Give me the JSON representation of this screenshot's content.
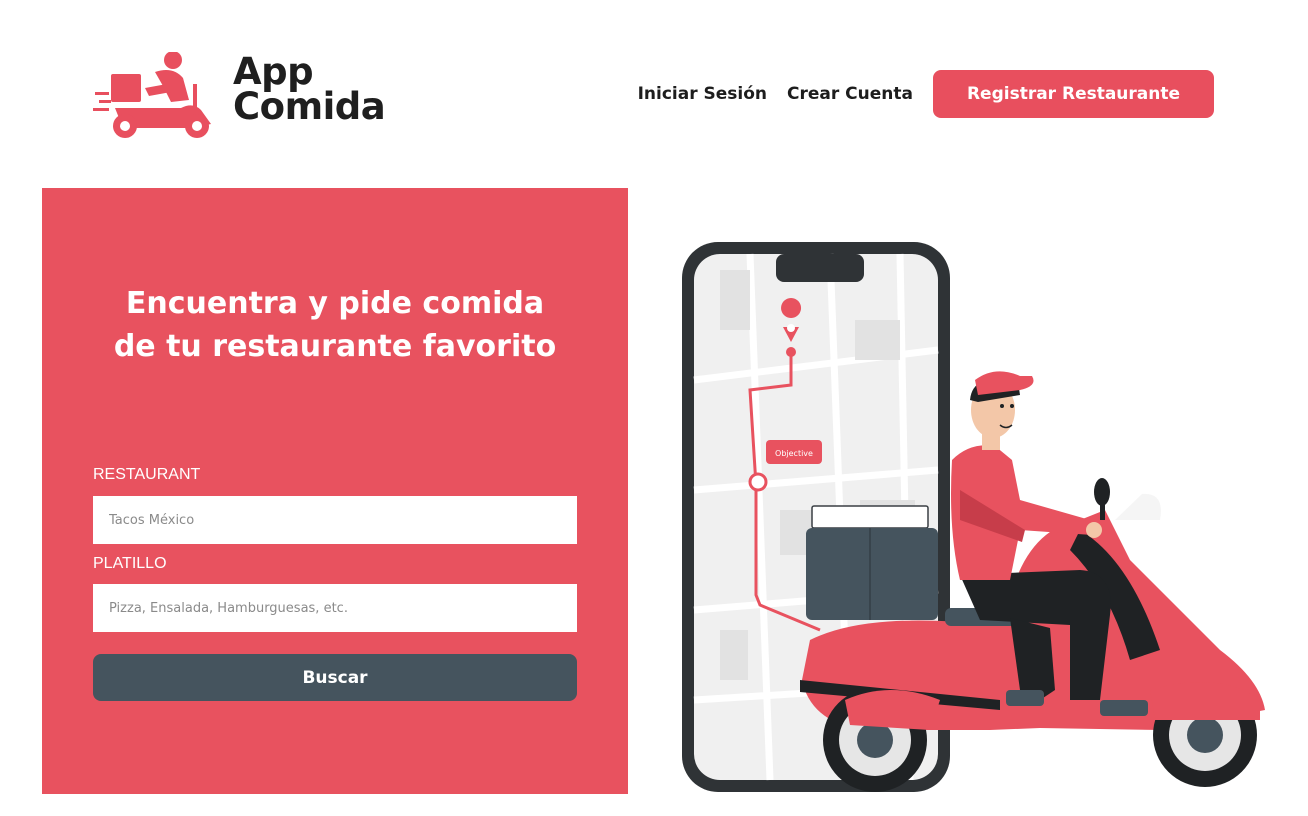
{
  "brand": {
    "line1": "App",
    "line2": "Comida",
    "accent_color": "#e84f5e",
    "icon": "delivery-scooter-icon"
  },
  "nav": {
    "login": "Iniciar Sesión",
    "signup": "Crear Cuenta",
    "register_restaurant": "Registrar Restaurante"
  },
  "hero": {
    "title_line1": "Encuentra y pide comida",
    "title_line2": "de tu restaurante favorito",
    "panel_color": "#e8525f"
  },
  "form": {
    "restaurant_label": "RESTAURANT",
    "restaurant_placeholder": "Tacos México",
    "dish_label": "PLATILLO",
    "dish_placeholder": "Pizza, Ensalada, Hamburguesas, etc.",
    "search_button": "Buscar",
    "button_color": "#45545e"
  },
  "illustration": {
    "map_tag": "Objective",
    "subject": "delivery-rider-illustration"
  }
}
